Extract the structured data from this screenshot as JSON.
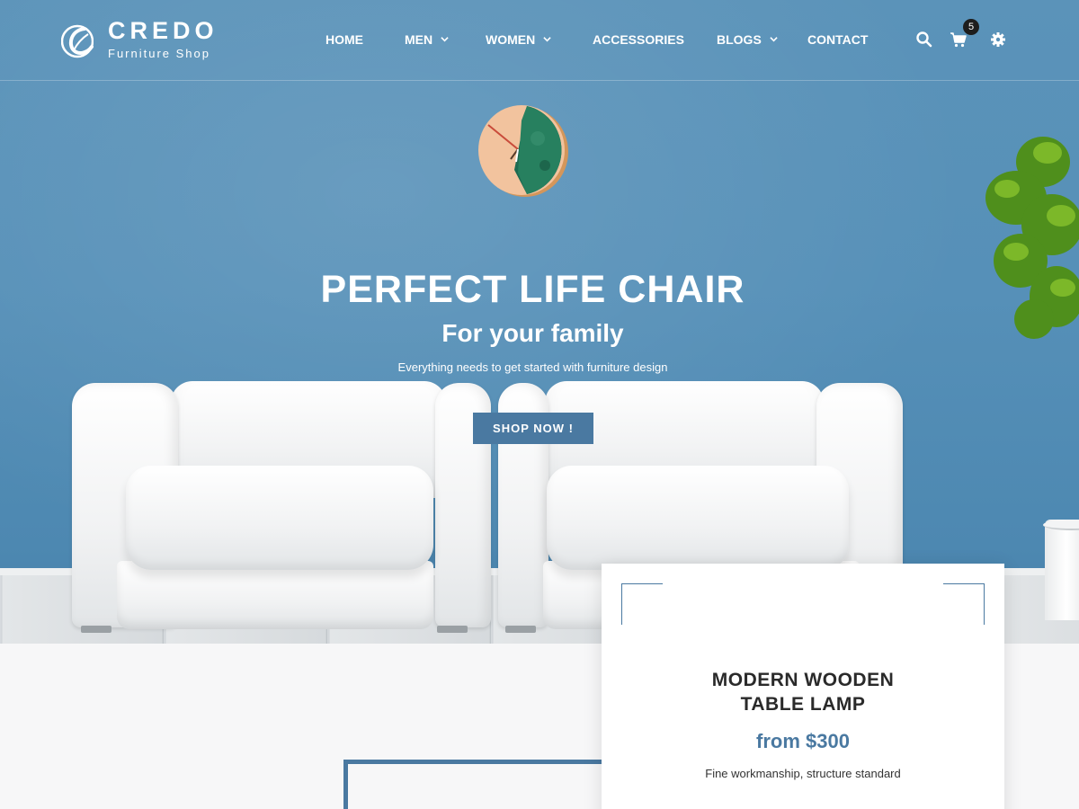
{
  "brand": {
    "name": "CREDO",
    "tagline": "Furniture Shop"
  },
  "nav": {
    "items": [
      {
        "label": "HOME",
        "has_dropdown": false
      },
      {
        "label": "MEN",
        "has_dropdown": true
      },
      {
        "label": "WOMEN",
        "has_dropdown": true
      },
      {
        "label": "ACCESSORIES",
        "has_dropdown": false
      },
      {
        "label": "BLOGS",
        "has_dropdown": true
      },
      {
        "label": "CONTACT",
        "has_dropdown": false
      }
    ]
  },
  "tools": {
    "search_icon": "search-icon",
    "cart_icon": "cart-icon",
    "cart_count": "5",
    "settings_icon": "gear-icon"
  },
  "hero": {
    "title": "PERFECT LIFE CHAIR",
    "subtitle": "For your family",
    "description": "Everything needs to get started with furniture design",
    "cta_label": "SHOP NOW !"
  },
  "featured_product": {
    "title_line1": "MODERN WOODEN",
    "title_line2": "TABLE LAMP",
    "price": "from $300",
    "description": "Fine workmanship, structure standard"
  },
  "colors": {
    "accent": "#4a79a1",
    "hero_wall": "#5690b8",
    "text_dark": "#2a2a2a"
  }
}
